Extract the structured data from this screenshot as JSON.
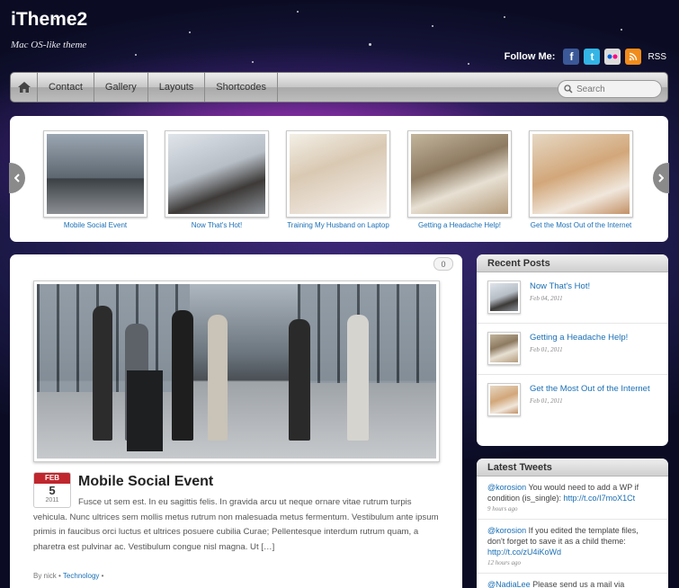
{
  "site": {
    "title": "iTheme2",
    "description": "Mac OS-like theme"
  },
  "follow": {
    "label": "Follow Me:",
    "rss_label": "RSS"
  },
  "nav": {
    "items": [
      "Contact",
      "Gallery",
      "Layouts",
      "Shortcodes"
    ],
    "search_placeholder": "Search"
  },
  "slider": {
    "items": [
      {
        "caption": "Mobile Social Event"
      },
      {
        "caption": "Now That's Hot!"
      },
      {
        "caption": "Training My Husband on Laptop"
      },
      {
        "caption": "Getting a Headache Help!"
      },
      {
        "caption": "Get the Most Out of the Internet"
      }
    ]
  },
  "post": {
    "comments": "0",
    "month": "FEB",
    "day": "5",
    "year": "2011",
    "title": "Mobile Social Event",
    "excerpt": "Fusce ut sem est. In eu sagittis felis. In gravida arcu ut neque ornare vitae rutrum turpis vehicula. Nunc ultrices sem mollis metus rutrum non malesuada metus fermentum. Vestibulum ante ipsum primis in faucibus orci luctus et ultrices posuere cubilia Curae; Pellentesque interdum rutrum quam, a pharetra est pulvinar ac. Vestibulum congue nisl magna. Ut […]",
    "meta_by": "By nick",
    "meta_sep": "•",
    "category": "Technology",
    "meta_end": "•"
  },
  "recent_posts": {
    "title": "Recent Posts",
    "items": [
      {
        "title": "Now That's Hot!",
        "date": "Feb 04, 2011"
      },
      {
        "title": "Getting a Headache Help!",
        "date": "Feb 01, 2011"
      },
      {
        "title": "Get the Most Out of the Internet",
        "date": "Feb 01, 2011"
      }
    ]
  },
  "latest_tweets": {
    "title": "Latest Tweets",
    "items": [
      {
        "user": "@korosion",
        "text": " You would need to add a WP if condition (is_single): ",
        "link": "http://t.co/I7moX1Ct",
        "time": "9 hours ago"
      },
      {
        "user": "@korosion",
        "text": " If you edited the template files, don't forget to save it as a child theme: ",
        "link": "http://t.co/zU4iKoWd",
        "time": "12 hours ago"
      },
      {
        "user": "@NadiaLee",
        "text": " Please send us a mail via",
        "link": "",
        "time": ""
      }
    ]
  },
  "icons": {
    "home": "home-icon",
    "facebook": "facebook-icon",
    "twitter": "twitter-icon",
    "flickr": "flickr-icon",
    "rss": "rss-icon",
    "search": "search-icon"
  }
}
